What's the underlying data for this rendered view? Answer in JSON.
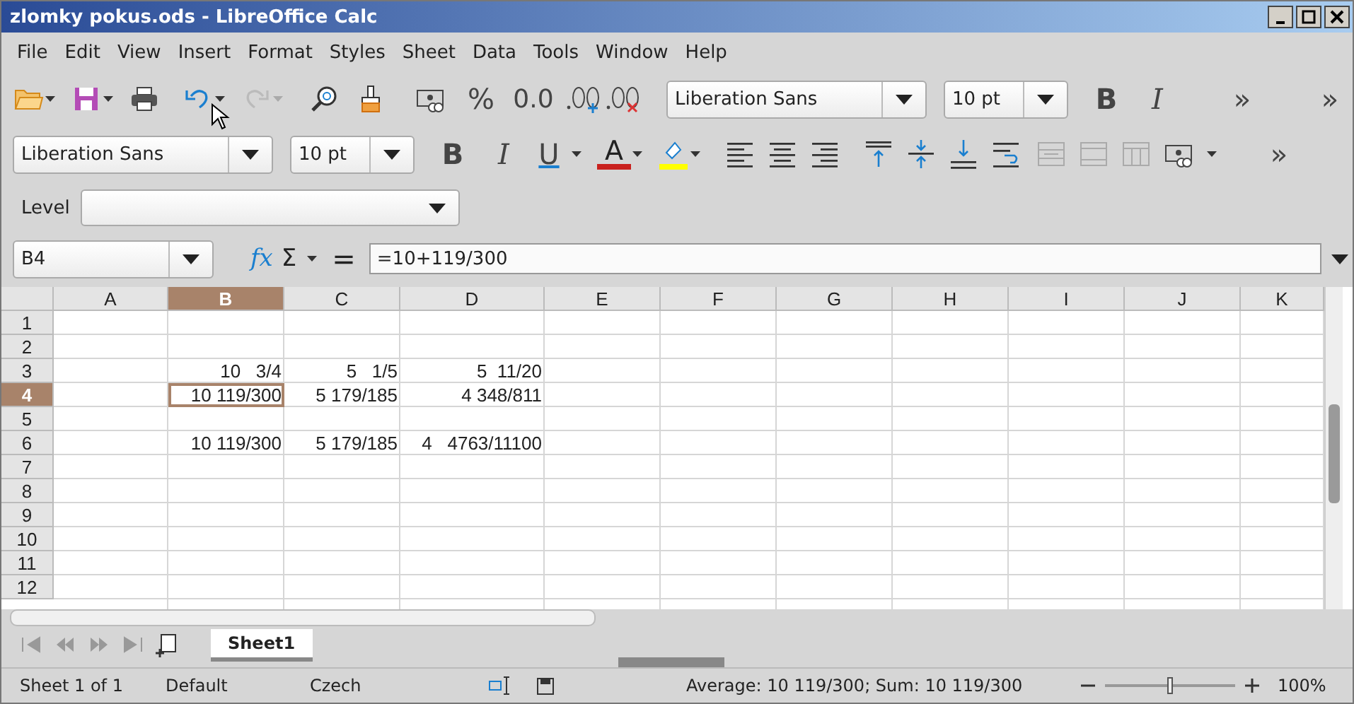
{
  "window": {
    "title": "zlomky pokus.ods - LibreOffice Calc"
  },
  "menu": [
    "File",
    "Edit",
    "View",
    "Insert",
    "Format",
    "Styles",
    "Sheet",
    "Data",
    "Tools",
    "Window",
    "Help"
  ],
  "standard_toolbar": {
    "percent": "%",
    "decimal": "0.0",
    "font": "Liberation Sans",
    "size": "10 pt",
    "bold": "B",
    "italic": "I",
    "more": "»",
    "more_2": "»"
  },
  "format_toolbar": {
    "font": "Liberation Sans",
    "size": "10 pt",
    "bold": "B",
    "italic": "I",
    "underline": "U",
    "font_color": "A",
    "more": "»"
  },
  "level": {
    "label": "Level"
  },
  "formula_bar": {
    "name_box": "B4",
    "function_wizard": "fx",
    "sum": "Σ",
    "equals": "=",
    "formula": "=10+119/300"
  },
  "sheet": {
    "columns": [
      {
        "label": "A",
        "selected": false
      },
      {
        "label": "B",
        "selected": true
      },
      {
        "label": "C",
        "selected": false
      },
      {
        "label": "D",
        "selected": false
      },
      {
        "label": "E",
        "selected": false
      },
      {
        "label": "F",
        "selected": false
      },
      {
        "label": "G",
        "selected": false
      },
      {
        "label": "H",
        "selected": false
      },
      {
        "label": "I",
        "selected": false
      },
      {
        "label": "J",
        "selected": false
      },
      {
        "label": "K",
        "selected": false
      }
    ],
    "rows": [
      {
        "label": "1",
        "selected": false
      },
      {
        "label": "2",
        "selected": false
      },
      {
        "label": "3",
        "selected": false,
        "B": "10   3/4",
        "C": "5   1/5",
        "D": "5  11/20"
      },
      {
        "label": "4",
        "selected": true,
        "B": "10 119/300",
        "C": "5 179/185",
        "D": "4 348/811"
      },
      {
        "label": "5",
        "selected": false
      },
      {
        "label": "6",
        "selected": false,
        "B": "10 119/300",
        "C": "5 179/185",
        "D": "4   4763/11100"
      },
      {
        "label": "7",
        "selected": false
      },
      {
        "label": "8",
        "selected": false
      },
      {
        "label": "9",
        "selected": false
      },
      {
        "label": "10",
        "selected": false
      },
      {
        "label": "11",
        "selected": false
      },
      {
        "label": "12",
        "selected": false
      }
    ]
  },
  "sheet_tabs": [
    {
      "label": "Sheet1",
      "selected": true
    }
  ],
  "status_bar": {
    "sheet": "Sheet 1 of 1",
    "page_style": "Default",
    "language": "Czech",
    "summary": "Average: 10 119/300; Sum: 10 119/300",
    "zoom": {
      "level": 0.5,
      "reading": "100%"
    }
  }
}
